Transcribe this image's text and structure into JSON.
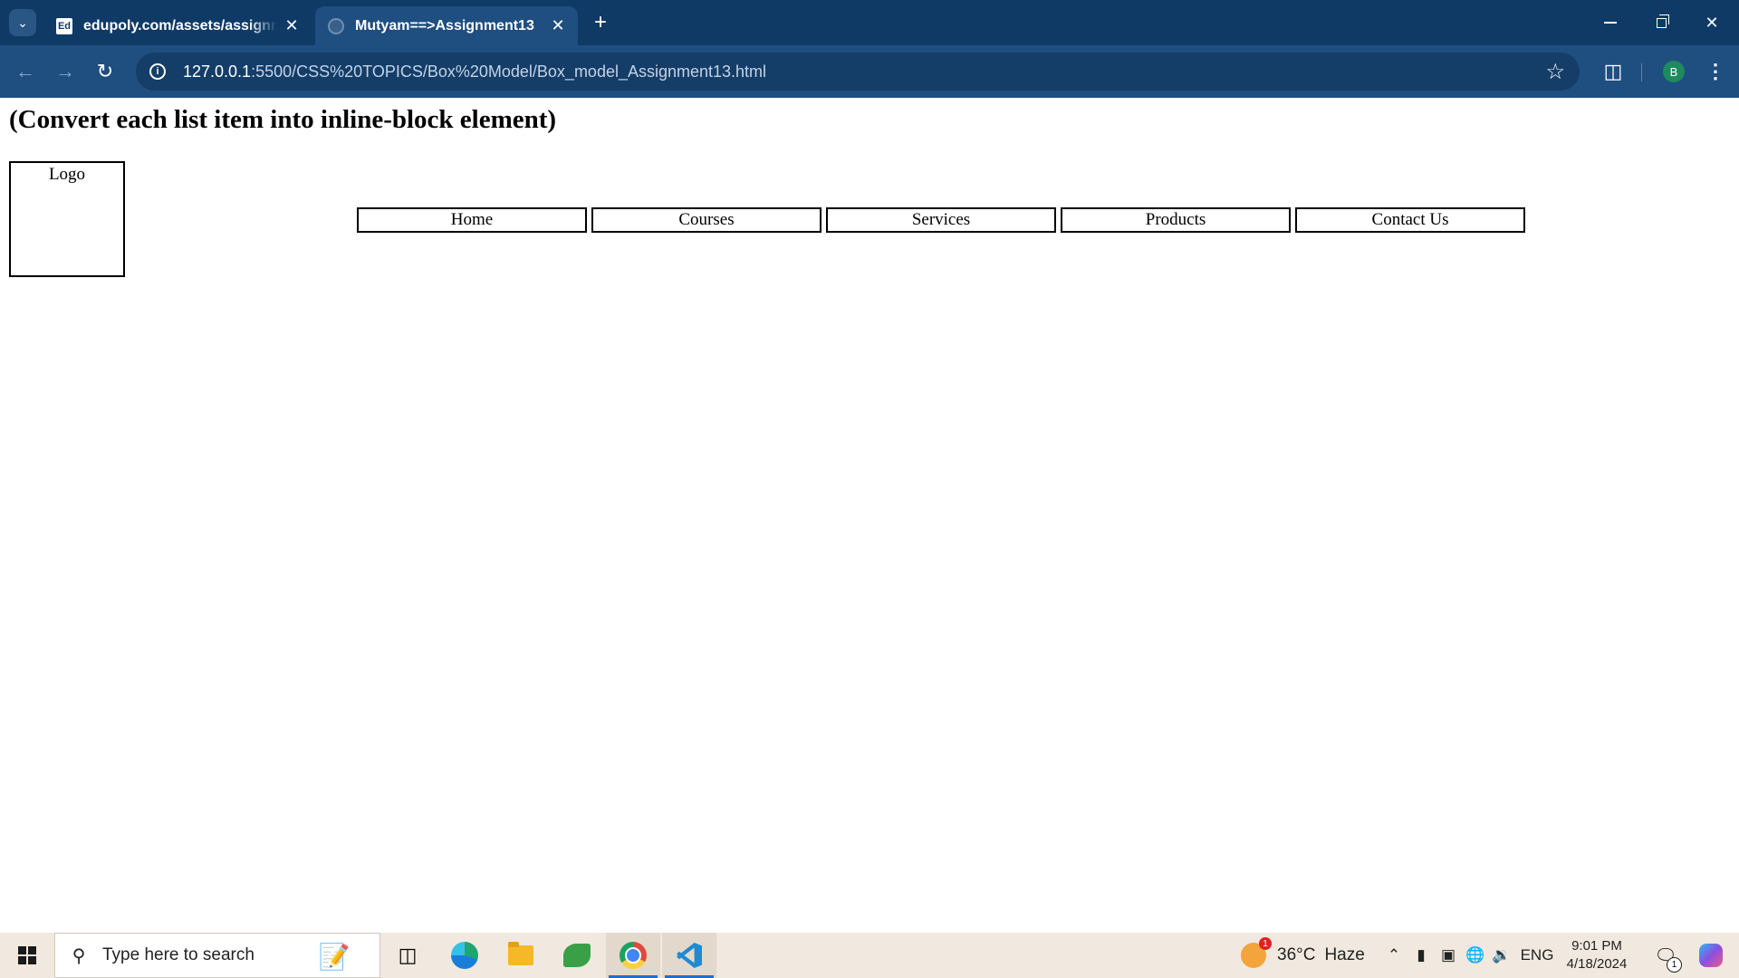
{
  "browser": {
    "tabs": [
      {
        "title": "edupoly.com/assets/assignments",
        "favicon": "Ed",
        "state": "inactive"
      },
      {
        "title": "Mutyam==>Assignment13",
        "favicon": "globe",
        "state": "active"
      }
    ],
    "url_host": "127.0.0.1",
    "url_path": ":5500/CSS%20TOPICS/Box%20Model/Box_model_Assignment13.html",
    "profile_initial": "B",
    "icons": {
      "tab_list": "chevron-down-icon",
      "close": "close-icon",
      "new_tab": "plus-icon",
      "back": "arrow-left-icon",
      "forward": "arrow-right-icon",
      "reload": "reload-icon",
      "site_info": "info-icon",
      "bookmark": "star-icon",
      "extensions": "puzzle-icon",
      "menu": "kebab-menu-icon"
    },
    "colors": {
      "frame": "#0f3a66",
      "toolbar": "#1f4e80"
    }
  },
  "page": {
    "heading": "(Convert each list item into inline-block element)",
    "logo_label": "Logo",
    "nav_items": [
      "Home",
      "Courses",
      "Services",
      "Products",
      "Contact Us"
    ]
  },
  "taskbar": {
    "search_placeholder": "Type here to search",
    "weather": {
      "temp": "36°C",
      "condition": "Haze",
      "badge": "1"
    },
    "language": "ENG",
    "time": "9:01 PM",
    "date": "4/18/2024",
    "notification_count": "1",
    "pinned_apps": [
      "task-view",
      "edge",
      "file-explorer",
      "spring-tool",
      "chrome",
      "vscode"
    ]
  }
}
